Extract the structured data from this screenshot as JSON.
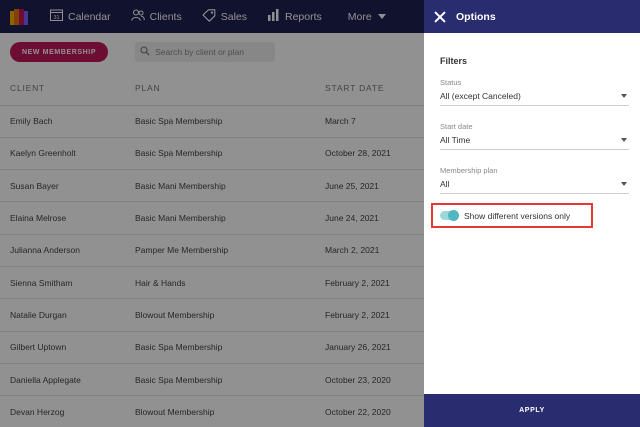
{
  "nav": {
    "items": [
      {
        "label": "Calendar",
        "icon": "calendar-icon",
        "badge": "31"
      },
      {
        "label": "Clients",
        "icon": "clients-icon"
      },
      {
        "label": "Sales",
        "icon": "tag-icon"
      },
      {
        "label": "Reports",
        "icon": "bar-chart-icon"
      }
    ],
    "more_label": "More"
  },
  "toolbar": {
    "new_button": "NEW MEMBERSHIP",
    "search_placeholder": "Search by client or plan"
  },
  "table": {
    "headers": [
      "CLIENT",
      "PLAN",
      "START DATE"
    ],
    "rows": [
      {
        "client": "Emily Bach",
        "plan": "Basic Spa Membership",
        "start": "March 7"
      },
      {
        "client": "Kaelyn Greenholt",
        "plan": "Basic Spa Membership",
        "start": "October 28, 2021"
      },
      {
        "client": "Susan Bayer",
        "plan": "Basic Mani Membership",
        "start": "June 25, 2021"
      },
      {
        "client": "Elaina Melrose",
        "plan": "Basic Mani Membership",
        "start": "June 24, 2021"
      },
      {
        "client": "Julianna Anderson",
        "plan": "Pamper Me Membership",
        "start": "March 2, 2021"
      },
      {
        "client": "Sienna Smitham",
        "plan": "Hair & Hands",
        "start": "February 2, 2021"
      },
      {
        "client": "Natalie Durgan",
        "plan": "Blowout Membership",
        "start": "February 2, 2021"
      },
      {
        "client": "Gilbert Uptown",
        "plan": "Basic Spa Membership",
        "start": "January 26, 2021"
      },
      {
        "client": "Daniella Applegate",
        "plan": "Basic Spa Membership",
        "start": "October 23, 2020"
      },
      {
        "client": "Devan Herzog",
        "plan": "Blowout Membership",
        "start": "October 22, 2020"
      }
    ]
  },
  "options": {
    "title": "Options",
    "filters_heading": "Filters",
    "status": {
      "label": "Status",
      "value": "All (except Canceled)"
    },
    "start_date": {
      "label": "Start date",
      "value": "All Time"
    },
    "plan": {
      "label": "Membership plan",
      "value": "All"
    },
    "toggle": {
      "label": "Show different versions only",
      "on": true
    },
    "apply_label": "APPLY"
  },
  "colors": {
    "nav_bg": "#1f2150",
    "panel_header": "#2a2c70",
    "new_button": "#c2185b",
    "toggle_on": "#4fb8bf",
    "highlight_border": "#e53935"
  }
}
